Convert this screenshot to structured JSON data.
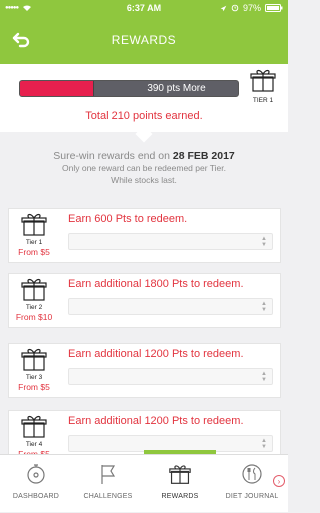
{
  "status_bar": {
    "carrier_signal": "●●●●●",
    "time": "6:37 AM",
    "battery": "97%"
  },
  "header": {
    "title": "REWARDS"
  },
  "progress": {
    "label": "390 pts More",
    "fill_fraction": 0.34,
    "tier_label": "TIER 1"
  },
  "total": {
    "text": "Total 210 points earned."
  },
  "info": {
    "line1_prefix": "Sure-win rewards end on",
    "line1_date": "28 FEB 2017",
    "line2": "Only one reward can be redeemed per Tier.",
    "line3": "While stocks last."
  },
  "tiers": [
    {
      "label": "Tier 1",
      "price": "From $5",
      "earn": "Earn 600 Pts to redeem."
    },
    {
      "label": "Tier 2",
      "price": "From $10",
      "earn": "Earn additional 1800 Pts to redeem."
    },
    {
      "label": "Tier 3",
      "price": "From $5",
      "earn": "Earn additional 1200 Pts to redeem."
    },
    {
      "label": "Tier 4",
      "price": "From $5",
      "earn": "Earn additional 1200 Pts to redeem."
    }
  ],
  "nav": {
    "items": [
      {
        "label": "DASHBOARD",
        "icon": "dashboard-icon"
      },
      {
        "label": "CHALLENGES",
        "icon": "flag-icon"
      },
      {
        "label": "REWARDS",
        "icon": "gift-icon",
        "active": true
      },
      {
        "label": "DIET JOURNAL",
        "icon": "diet-icon"
      }
    ]
  },
  "colors": {
    "brand": "#8fc73e",
    "accent_red": "#e2343f",
    "progress_fill": "#e7204e"
  }
}
